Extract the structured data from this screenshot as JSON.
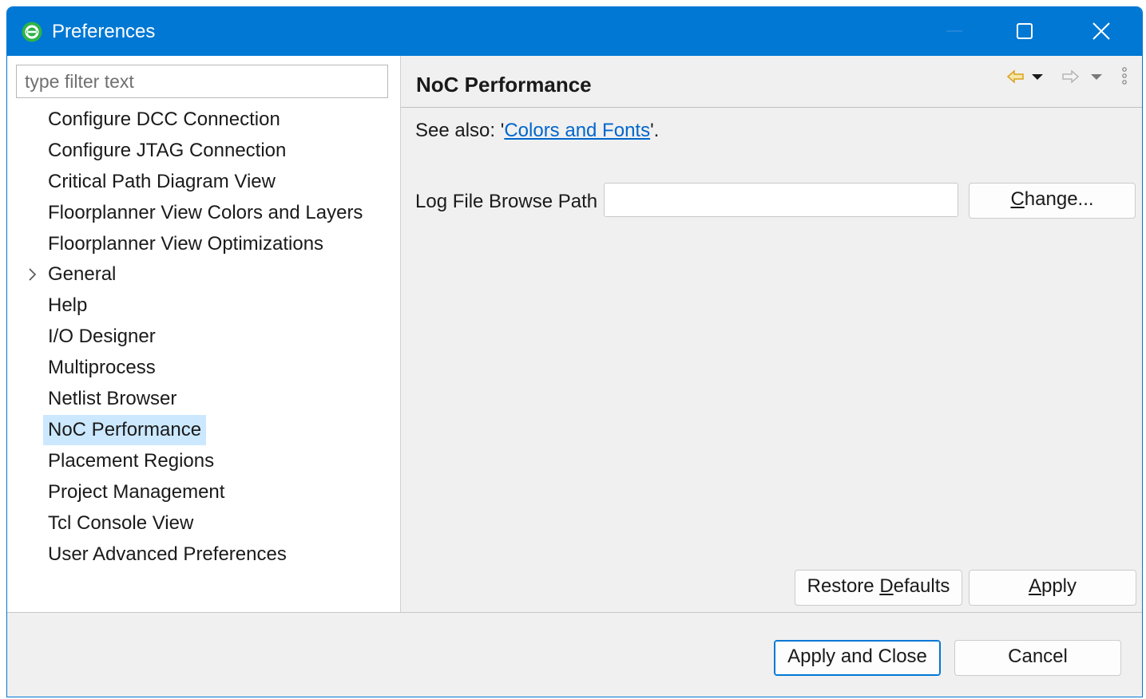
{
  "window": {
    "title": "Preferences",
    "accent_color": "#0078d4",
    "icons": [
      "app-logo-icon",
      "minimize-icon",
      "maximize-icon",
      "close-icon"
    ]
  },
  "filter": {
    "placeholder": "type filter text",
    "value": ""
  },
  "tree": {
    "items": [
      {
        "label": "Configure DCC Connection",
        "expandable": false,
        "selected": false
      },
      {
        "label": "Configure JTAG Connection",
        "expandable": false,
        "selected": false
      },
      {
        "label": "Critical Path Diagram View",
        "expandable": false,
        "selected": false
      },
      {
        "label": "Floorplanner View Colors and Layers",
        "expandable": false,
        "selected": false
      },
      {
        "label": "Floorplanner View Optimizations",
        "expandable": false,
        "selected": false
      },
      {
        "label": "General",
        "expandable": true,
        "selected": false
      },
      {
        "label": "Help",
        "expandable": false,
        "selected": false
      },
      {
        "label": "I/O Designer",
        "expandable": false,
        "selected": false
      },
      {
        "label": "Multiprocess",
        "expandable": false,
        "selected": false
      },
      {
        "label": "Netlist Browser",
        "expandable": false,
        "selected": false
      },
      {
        "label": "NoC Performance",
        "expandable": false,
        "selected": true
      },
      {
        "label": "Placement Regions",
        "expandable": false,
        "selected": false
      },
      {
        "label": "Project Management",
        "expandable": false,
        "selected": false
      },
      {
        "label": "Tcl Console View",
        "expandable": false,
        "selected": false
      },
      {
        "label": "User Advanced Preferences",
        "expandable": false,
        "selected": false
      }
    ],
    "selection_color": "#cce8ff"
  },
  "page": {
    "title": "NoC Performance",
    "see_also_prefix": "See also: '",
    "see_also_link": "Colors and Fonts",
    "see_also_suffix": "'.",
    "link_color": "#0066cc",
    "log_path_label": "Log File Browse Path",
    "log_path_value": "",
    "change_button": {
      "mnemonic": "C",
      "rest": "hange..."
    },
    "restore_defaults_button": {
      "before": "Restore ",
      "mnemonic": "D",
      "rest": "efaults"
    },
    "apply_button": {
      "mnemonic": "A",
      "rest": "pply"
    }
  },
  "dialog_buttons": {
    "apply_and_close": "Apply and Close",
    "cancel": "Cancel"
  }
}
